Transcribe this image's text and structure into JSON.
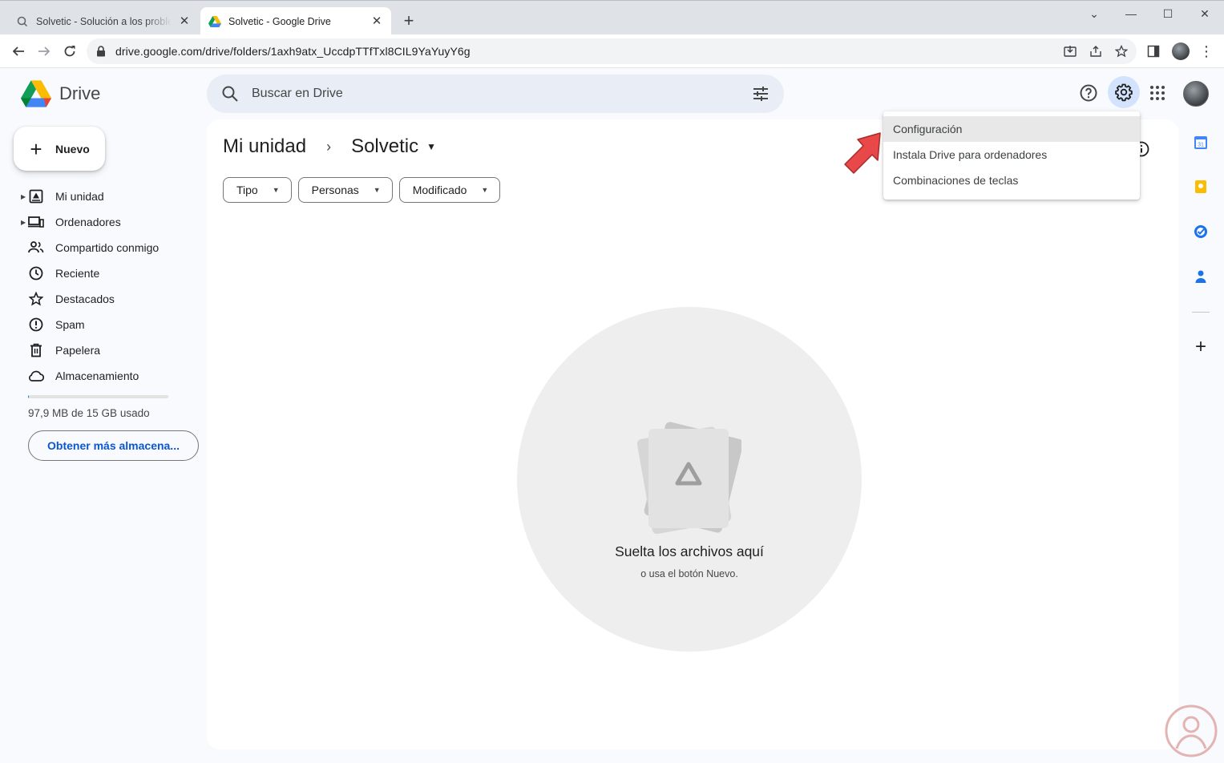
{
  "browser": {
    "tabs": [
      {
        "title": "Solvetic - Solución a los problemas"
      },
      {
        "title": "Solvetic - Google Drive"
      }
    ],
    "url": "drive.google.com/drive/folders/1axh9atx_UccdpTTfTxl8CIL9YaYuyY6g"
  },
  "app": {
    "name": "Drive",
    "search_placeholder": "Buscar en Drive",
    "new_button": "Nuevo",
    "nav": [
      {
        "label": "Mi unidad",
        "icon": "my-drive-icon"
      },
      {
        "label": "Ordenadores",
        "icon": "computers-icon"
      },
      {
        "label": "Compartido conmigo",
        "icon": "shared-icon"
      },
      {
        "label": "Reciente",
        "icon": "clock-icon"
      },
      {
        "label": "Destacados",
        "icon": "star-icon"
      },
      {
        "label": "Spam",
        "icon": "spam-icon"
      },
      {
        "label": "Papelera",
        "icon": "trash-icon"
      },
      {
        "label": "Almacenamiento",
        "icon": "cloud-icon"
      }
    ],
    "storage": {
      "text": "97,9 MB de 15 GB usado",
      "used_fraction": 0.0065,
      "button": "Obtener más almacena..."
    }
  },
  "main": {
    "breadcrumb": [
      "Mi unidad",
      "Solvetic"
    ],
    "filters": [
      "Tipo",
      "Personas",
      "Modificado"
    ],
    "empty_title": "Suelta los archivos aquí",
    "empty_subtitle": "o usa el botón Nuevo."
  },
  "settings_menu": {
    "items": [
      "Configuración",
      "Instala Drive para ordenadores",
      "Combinaciones de teclas"
    ]
  },
  "colors": {
    "accent": "#0b57d0",
    "highlight": "#d3e3fd",
    "arrow": "#e94848"
  }
}
